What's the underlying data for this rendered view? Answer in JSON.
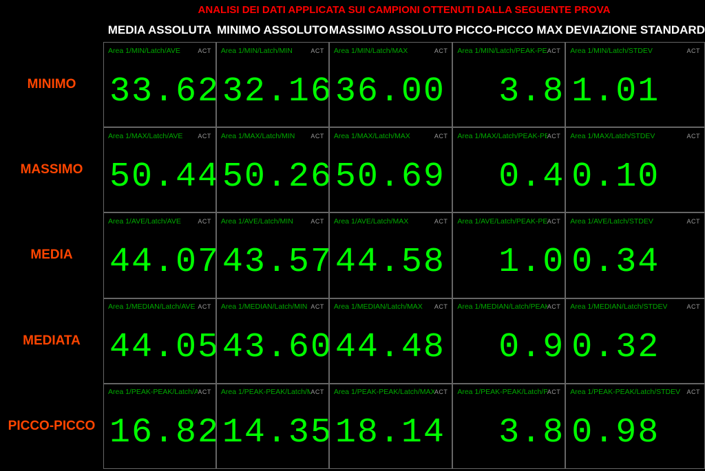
{
  "title": "ANALISI DEI DATI APPLICATA SUI CAMPIONI OTTENUTI DALLA SEGUENTE PROVA",
  "act_label": "ACT",
  "columns": [
    {
      "header": "MEDIA ASSOLUTA",
      "stat_key": "AVE"
    },
    {
      "header": "MINIMO ASSOLUTO",
      "stat_key": "MIN"
    },
    {
      "header": "MASSIMO ASSOLUTO",
      "stat_key": "MAX"
    },
    {
      "header": "PICCO-PICCO MAX",
      "stat_key": "PEAK-PEAK"
    },
    {
      "header": "DEVIAZIONE STANDARD",
      "stat_key": "STDEV"
    }
  ],
  "rows": [
    {
      "label": "MINIMO",
      "row_key": "MIN",
      "values": [
        "33.62",
        "32.16",
        "36.00",
        "3.8",
        "1.01"
      ]
    },
    {
      "label": "MASSIMO",
      "row_key": "MAX",
      "values": [
        "50.44",
        "50.26",
        "50.69",
        "0.4",
        "0.10"
      ]
    },
    {
      "label": "MEDIA",
      "row_key": "AVE",
      "values": [
        "44.07",
        "43.57",
        "44.58",
        "1.0",
        "0.34"
      ]
    },
    {
      "label": "MEDIATA",
      "row_key": "MEDIAN",
      "values": [
        "44.05",
        "43.60",
        "44.48",
        "0.9",
        "0.32"
      ]
    },
    {
      "label": "PICCO-PICCO",
      "row_key": "PEAK-PEAK",
      "values": [
        "16.82",
        "14.35",
        "18.14",
        "3.8",
        "0.98"
      ]
    }
  ],
  "path_prefix": "Area 1/",
  "path_mid": "/Latch/"
}
